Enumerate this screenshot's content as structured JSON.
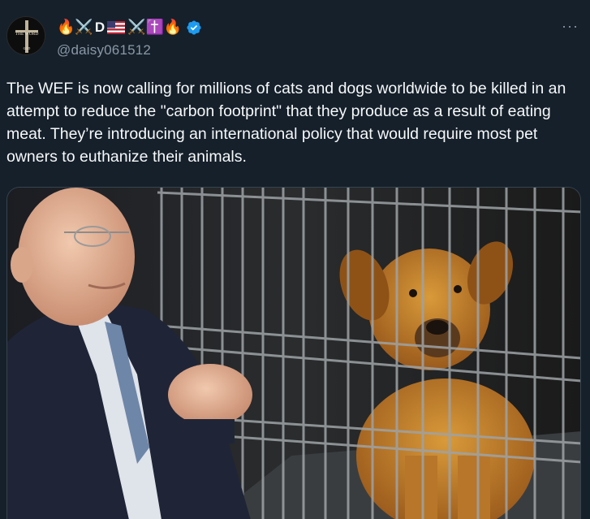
{
  "author": {
    "display_name_prefix": "🔥⚔️",
    "display_name_letter": "D",
    "display_name_suffix": "⚔️✝️🔥",
    "handle": "@daisy061512",
    "avatar_text_top": "THE WORD",
    "avatar_text_bottom": "GOD"
  },
  "tweet": {
    "text": "The WEF is now calling for millions of cats and dogs worldwide to be killed in an attempt to reduce the \"carbon footprint\" that they produce as a result of eating meat. They’re introducing an international policy that would require most pet owners to euthanize their animals."
  },
  "colors": {
    "background": "#15202b",
    "text_primary": "#f7f9f9",
    "text_secondary": "#8b98a5",
    "verified_blue": "#1d9bf0"
  },
  "icons": {
    "more": "more-horizontal-icon",
    "verified": "verified-badge-icon"
  }
}
